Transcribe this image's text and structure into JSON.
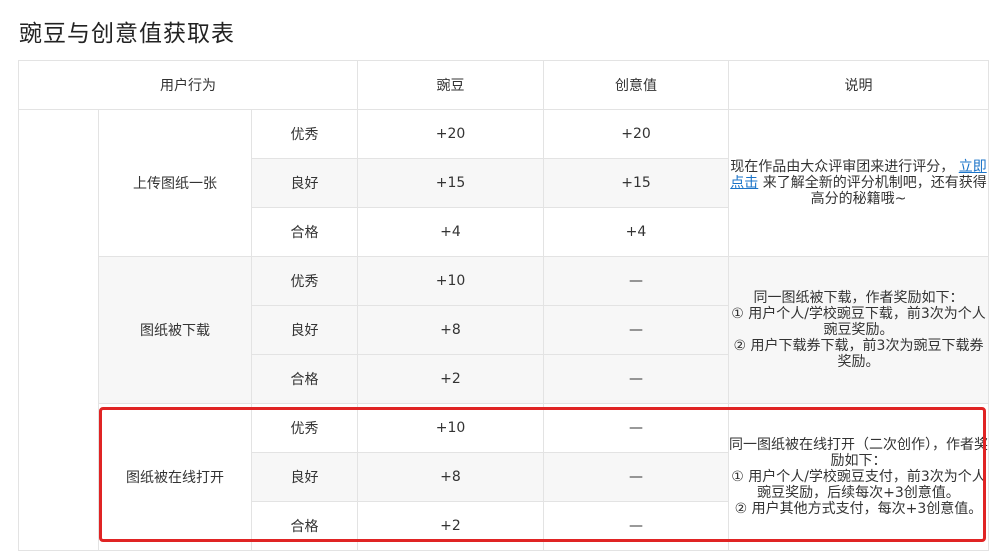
{
  "title": "豌豆与创意值获取表",
  "table": {
    "headers": {
      "action": "用户行为",
      "peas": "豌豆",
      "creativity": "创意值",
      "note": "说明"
    },
    "groups": [
      {
        "action": "上传图纸一张",
        "rows": [
          {
            "level": "优秀",
            "peas": "+20",
            "creativity": "+20"
          },
          {
            "level": "良好",
            "peas": "+15",
            "creativity": "+15"
          },
          {
            "level": "合格",
            "peas": "+4",
            "creativity": "+4"
          }
        ],
        "note_before": "现在作品由大众评审团来进行评分，",
        "note_link": "立即点击",
        "note_after": "来了解全新的评分机制吧，还有获得高分的秘籍哦~"
      },
      {
        "action": "图纸被下载",
        "rows": [
          {
            "level": "优秀",
            "peas": "+10",
            "creativity": "—"
          },
          {
            "level": "良好",
            "peas": "+8",
            "creativity": "—"
          },
          {
            "level": "合格",
            "peas": "+2",
            "creativity": "—"
          }
        ],
        "note": "同一图纸被下载，作者奖励如下：\n① 用户个人/学校豌豆下载，前3次为个人豌豆奖励。\n② 用户下载券下载，前3次为豌豆下载券奖励。"
      },
      {
        "action": "图纸被在线打开",
        "rows": [
          {
            "level": "优秀",
            "peas": "+10",
            "creativity": "—"
          },
          {
            "level": "良好",
            "peas": "+8",
            "creativity": "—"
          },
          {
            "level": "合格",
            "peas": "+2",
            "creativity": "—"
          }
        ],
        "note": "同一图纸被在线打开（二次创作），作者奖励如下：\n① 用户个人/学校豌豆支付，前3次为个人豌豆奖励，后续每次+3创意值。\n② 用户其他方式支付，每次+3创意值。"
      }
    ]
  }
}
